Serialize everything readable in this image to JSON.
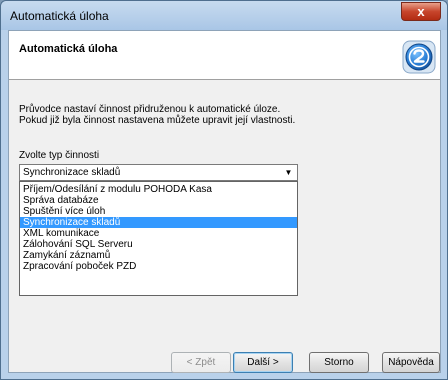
{
  "window": {
    "title": "Automatická úloha",
    "close_label": "x"
  },
  "header": {
    "title": "Automatická úloha",
    "icon": "pohoda-wizard-icon"
  },
  "description": {
    "line1": "Průvodce nastaví činnost přidruženou k automatické úloze.",
    "line2": "Pokud již byla činnost nastavena můžete upravit její vlastnosti."
  },
  "activity": {
    "label": "Zvolte typ činnosti",
    "selected": "Synchronizace skladů",
    "options": [
      "Příjem/Odesílání z modulu POHODA Kasa",
      "Správa databáze",
      "Spuštění více úloh",
      "Synchronizace skladů",
      "XML komunikace",
      "Zálohování SQL Serveru",
      "Zamykání záznamů",
      "Zpracování poboček PZD"
    ],
    "selected_index": 3
  },
  "buttons": {
    "back": "< Zpět",
    "next": "Další >",
    "cancel": "Storno",
    "help": "Nápověda"
  },
  "colors": {
    "accent": "#3399ff",
    "title_bar": "#b9d1ea",
    "close": "#c7452c"
  }
}
